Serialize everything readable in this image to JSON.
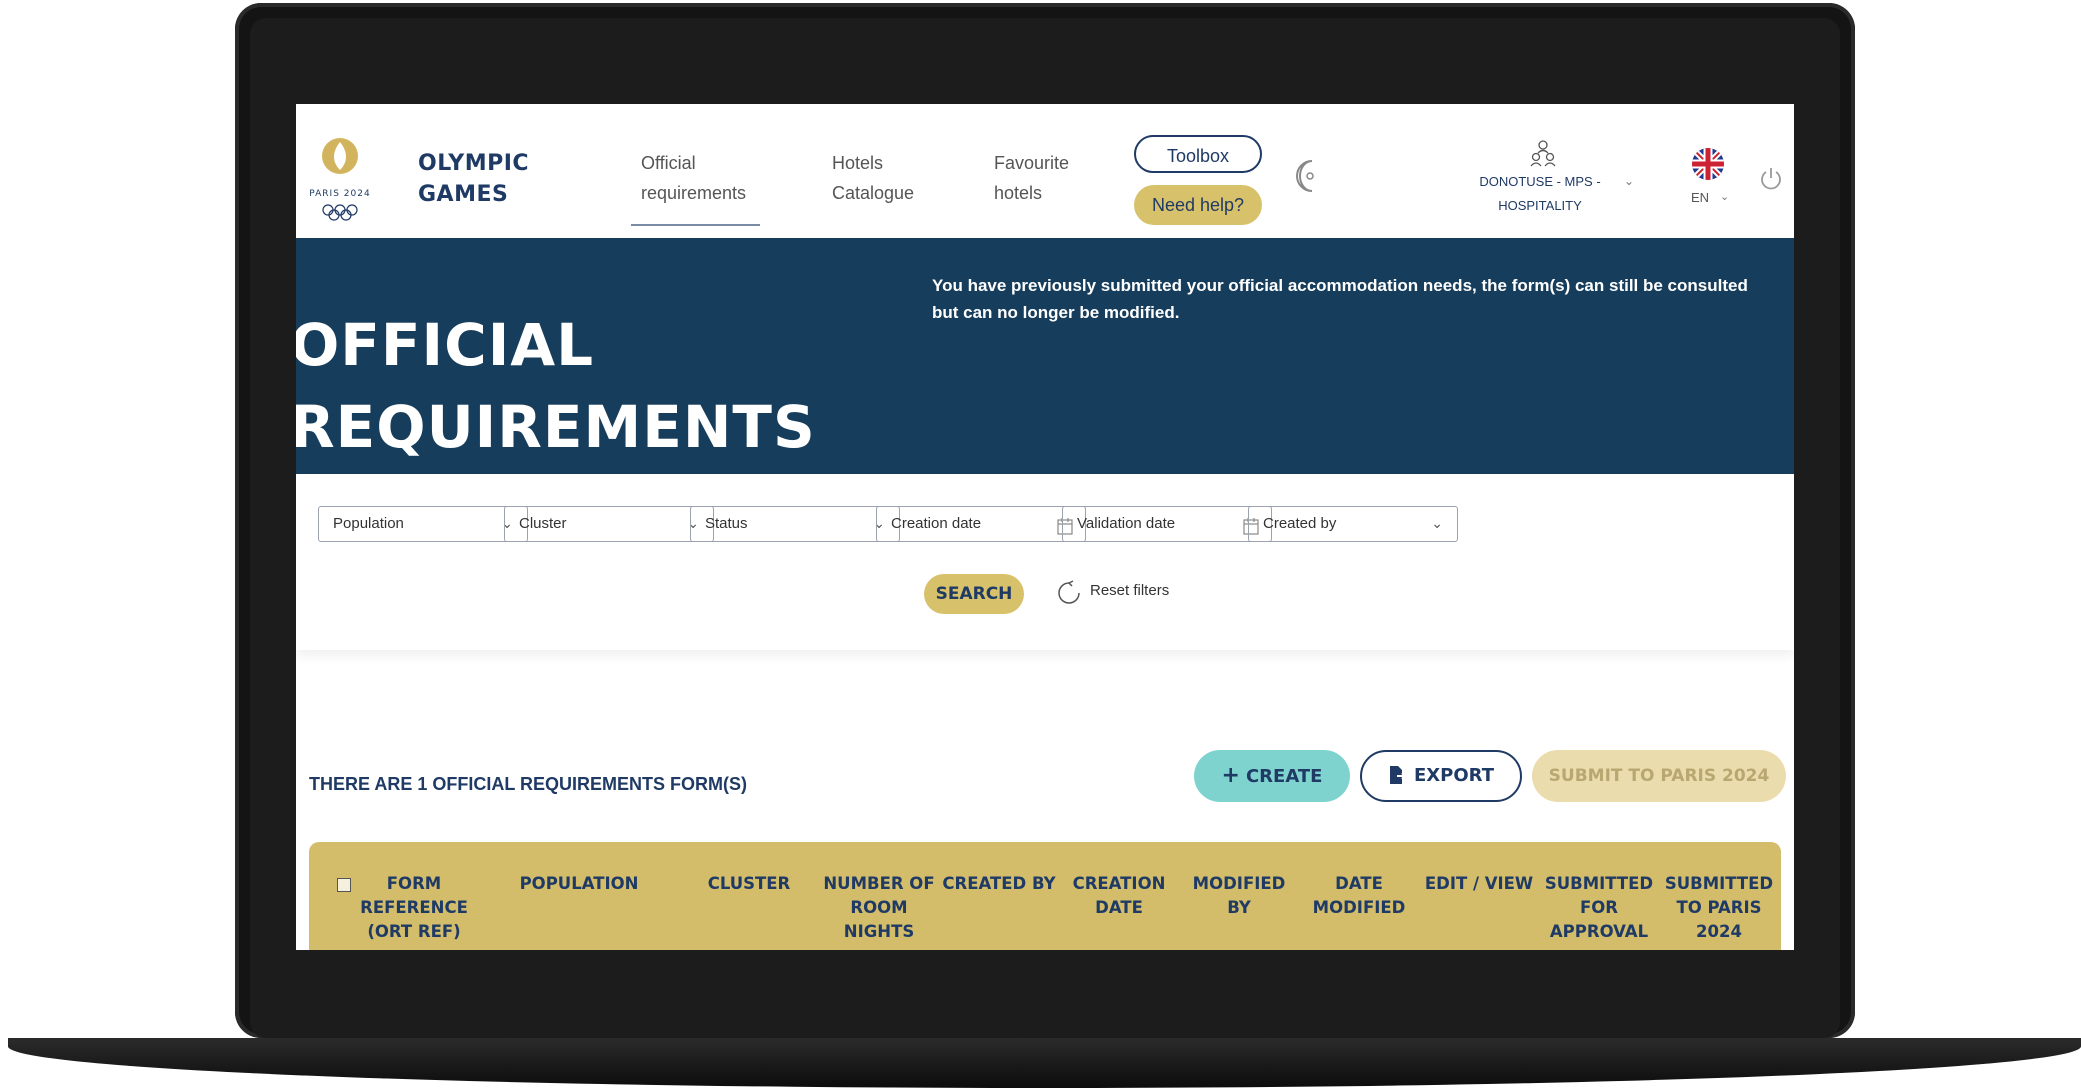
{
  "header": {
    "brand_line1": "OLYMPIC",
    "brand_line2": "GAMES",
    "logo_text": "PARIS 2024",
    "nav": [
      {
        "line1": "Official",
        "line2": "requirements"
      },
      {
        "line1": "Hotels",
        "line2": "Catalogue"
      },
      {
        "line1": "Favourite",
        "line2": "hotels"
      }
    ],
    "toolbox": "Toolbox",
    "need_help": "Need help?",
    "user_line1": "DONOTUSE - MPS -",
    "user_line2": "HOSPITALITY",
    "lang": "EN"
  },
  "hero": {
    "title_line1": "OFFICIAL",
    "title_line2": "REQUIREMENTS",
    "message": "You have previously submitted your official accommodation needs, the form(s) can still be consulted but can no longer be modified."
  },
  "filters": {
    "population": "Population",
    "cluster": "Cluster",
    "status": "Status",
    "creation_date": "Creation date",
    "validation_date": "Validation date",
    "created_by": "Created by",
    "search": "SEARCH",
    "reset": "Reset filters"
  },
  "actions": {
    "count_text": "THERE ARE 1 OFFICIAL REQUIREMENTS FORM(S)",
    "create": "CREATE",
    "export": "EXPORT",
    "submit": "SUBMIT TO PARIS 2024"
  },
  "table": {
    "columns": [
      [
        "FORM",
        "REFERENCE",
        "(ORT REF)"
      ],
      [
        "POPULATION"
      ],
      [
        "CLUSTER"
      ],
      [
        "NUMBER OF",
        "ROOM",
        "NIGHTS"
      ],
      [
        "CREATED BY"
      ],
      [
        "CREATION",
        "DATE"
      ],
      [
        "MODIFIED BY"
      ],
      [
        "DATE",
        "MODIFIED"
      ],
      [
        "EDIT / VIEW"
      ],
      [
        "SUBMITTED",
        "FOR",
        "APPROVAL"
      ],
      [
        "SUBMITTED",
        "TO PARIS",
        "2024"
      ]
    ]
  },
  "colors": {
    "navy": "#173d5c",
    "gold": "#d3bd6a",
    "teal": "#7fd3cf"
  }
}
